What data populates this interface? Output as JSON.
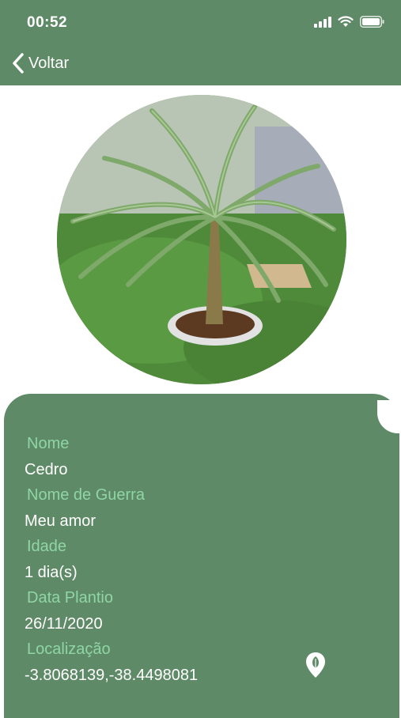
{
  "status_bar": {
    "time": "00:52"
  },
  "nav": {
    "back_label": "Voltar"
  },
  "colors": {
    "header": "#5f8a67",
    "card": "#5f8a67",
    "label": "#8fd6a4",
    "value": "#ffffff"
  },
  "plant": {
    "fields": [
      {
        "label": "Nome",
        "value": "Cedro"
      },
      {
        "label": "Nome de Guerra",
        "value": "Meu amor"
      },
      {
        "label": "Idade",
        "value": "1 dia(s)"
      },
      {
        "label": "Data Plantio",
        "value": "26/11/2020"
      },
      {
        "label": "Localização",
        "value": "-3.8068139,-38.4498081"
      }
    ]
  },
  "icons": {
    "back": "chevron-left-icon",
    "location": "map-pin-icon"
  }
}
